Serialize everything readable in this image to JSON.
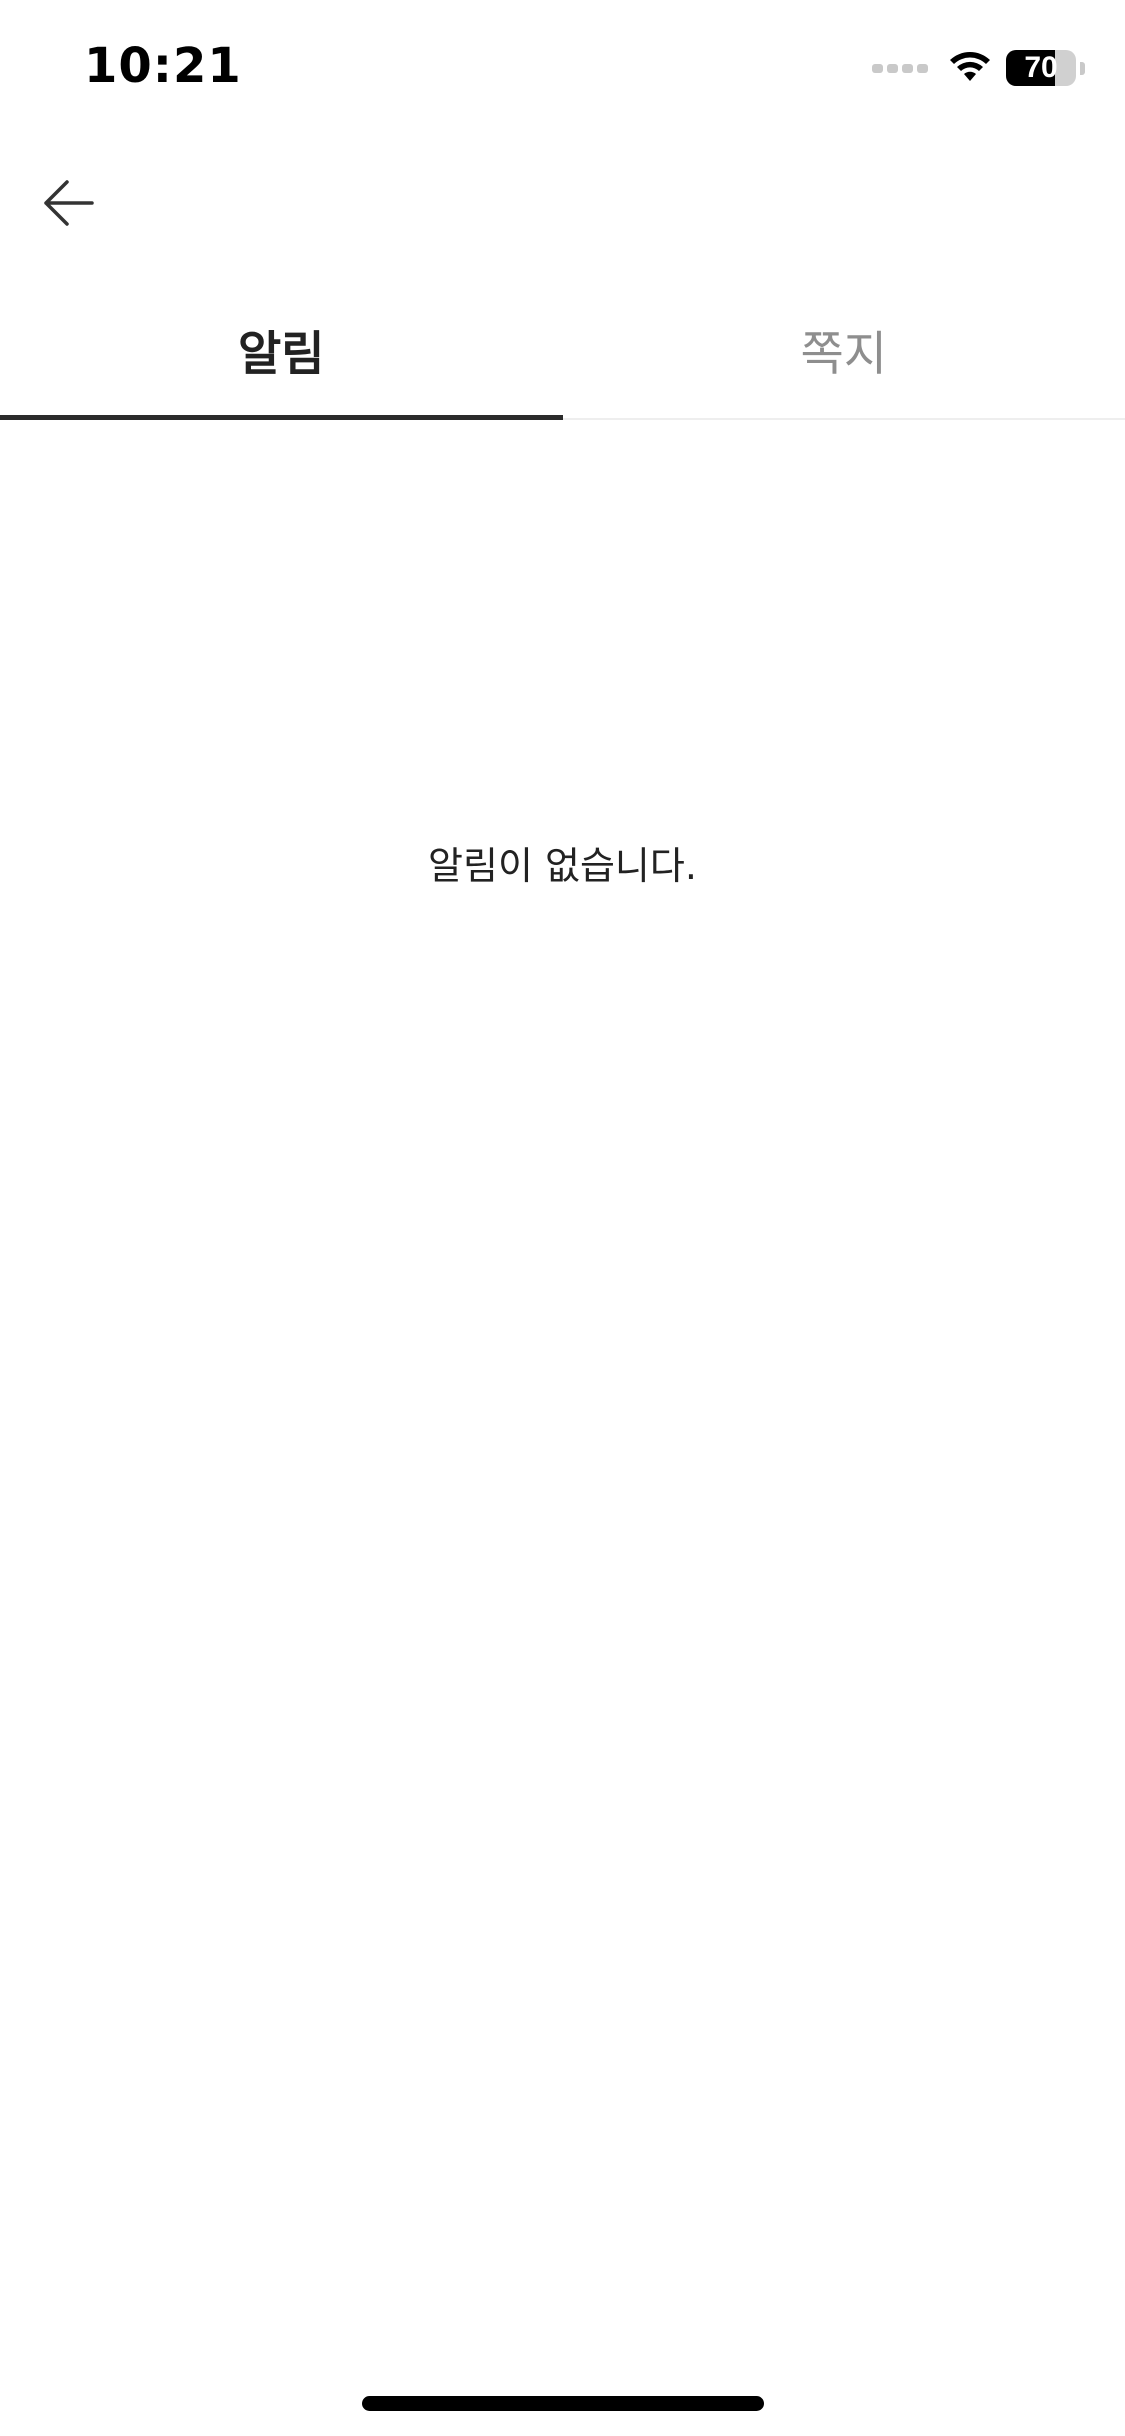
{
  "status_bar": {
    "time": "10:21",
    "battery_level": "70",
    "battery_fraction": 0.7,
    "icons": [
      "cellular-signal-icon",
      "wifi-icon",
      "battery-icon"
    ]
  },
  "header": {
    "back_icon": "arrow-left-icon"
  },
  "tabs": [
    {
      "label": "알림",
      "active": true
    },
    {
      "label": "쪽지",
      "active": false
    }
  ],
  "empty_state": {
    "message": "알림이 없습니다."
  },
  "colors": {
    "active_tab_text": "#222222",
    "inactive_tab_text": "#8e8e8e",
    "active_tab_underline": "#2b2b2b",
    "background": "#ffffff"
  }
}
